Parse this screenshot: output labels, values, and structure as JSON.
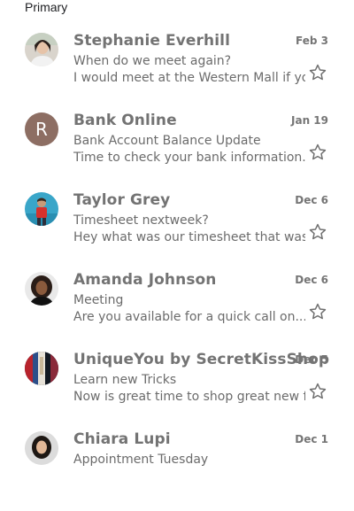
{
  "section": {
    "label": "Primary"
  },
  "emails": [
    {
      "sender": "Stephanie Everhill",
      "date": "Feb 3",
      "subject": "When do we meet again?",
      "snippet": "I would meet at the Western Mall if you..",
      "avatar": {
        "type": "photo",
        "icon": "person-photo-icon"
      },
      "starred": false
    },
    {
      "sender": "Bank Online",
      "date": "Jan 19",
      "subject": "Bank Account Balance Update",
      "snippet": "Time to check your bank information...",
      "avatar": {
        "type": "letter",
        "letter": "R",
        "color": "#8d6e63"
      },
      "starred": false
    },
    {
      "sender": "Taylor Grey",
      "date": "Dec 6",
      "subject": "Timesheet nextweek?",
      "snippet": "Hey what was our timesheet that was...",
      "avatar": {
        "type": "photo",
        "icon": "person-photo-icon"
      },
      "starred": false
    },
    {
      "sender": "Amanda Johnson",
      "date": "Dec 6",
      "subject": "Meeting",
      "snippet": "Are you available for a quick call on...",
      "avatar": {
        "type": "photo",
        "icon": "person-photo-icon"
      },
      "starred": false
    },
    {
      "sender": "UniqueYou by SecretKissShop",
      "date": "Dec 5",
      "subject": "Learn new Tricks",
      "snippet": "Now is great time to shop great new fash..",
      "avatar": {
        "type": "photo",
        "icon": "shop-photo-icon"
      },
      "starred": false
    },
    {
      "sender": "Chiara Lupi",
      "date": "Dec 1",
      "subject": "Appointment Tuesday",
      "snippet": "",
      "avatar": {
        "type": "photo",
        "icon": "person-photo-icon"
      },
      "starred": false
    }
  ]
}
